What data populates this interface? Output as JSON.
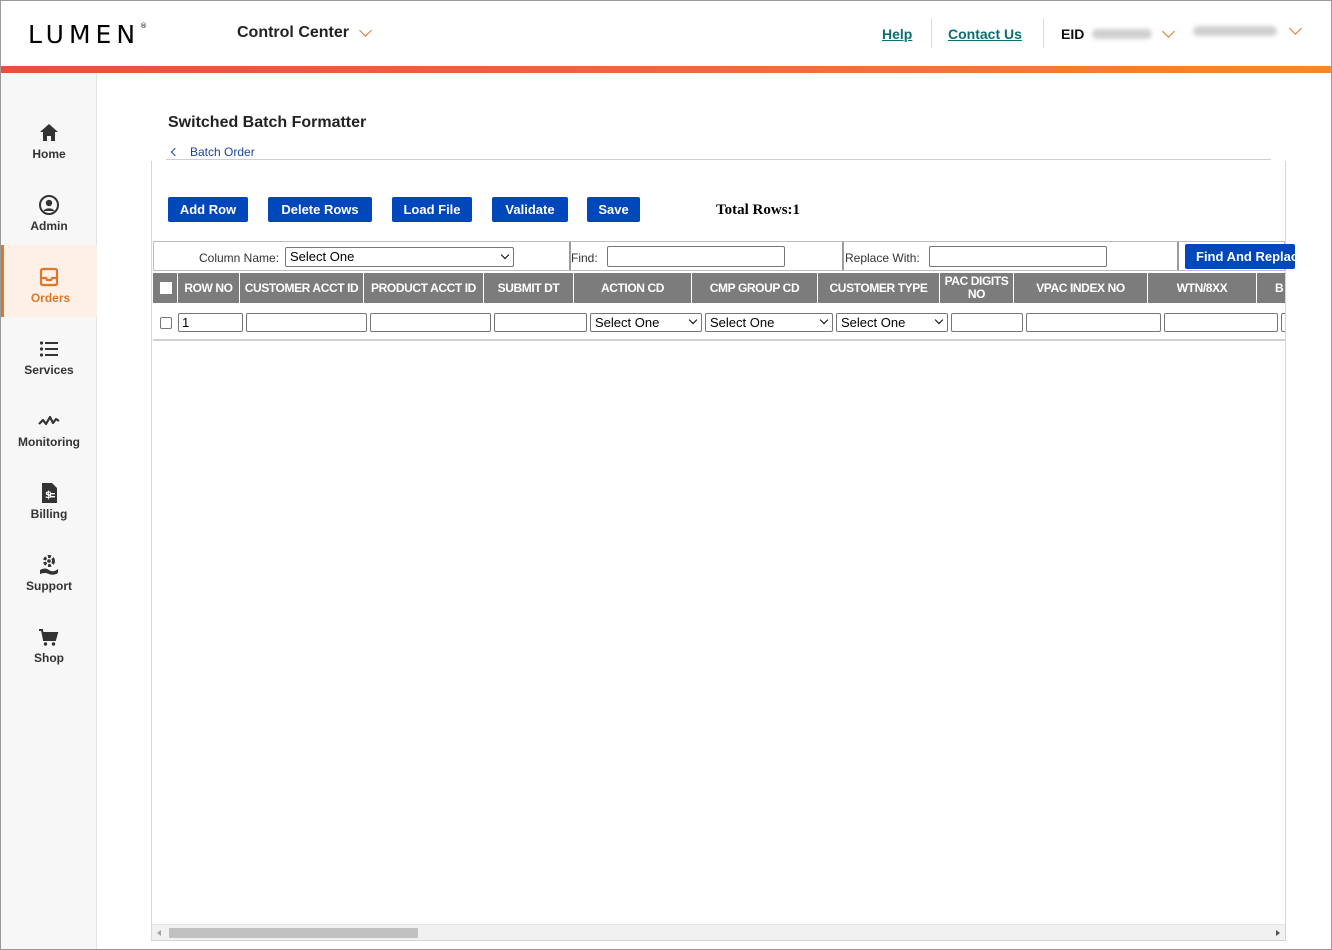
{
  "header": {
    "logo": "LUMEN",
    "logo_mark": "®",
    "product_menu": "Control Center",
    "help": "Help",
    "contact": "Contact Us",
    "eid_label": "EID"
  },
  "sidebar": {
    "items": [
      {
        "label": "Home",
        "icon": "home-icon"
      },
      {
        "label": "Admin",
        "icon": "user-icon"
      },
      {
        "label": "Orders",
        "icon": "inbox-icon"
      },
      {
        "label": "Services",
        "icon": "list-icon"
      },
      {
        "label": "Monitoring",
        "icon": "pulse-icon"
      },
      {
        "label": "Billing",
        "icon": "billing-icon"
      },
      {
        "label": "Support",
        "icon": "support-icon"
      },
      {
        "label": "Shop",
        "icon": "cart-icon"
      }
    ],
    "active": "Orders",
    "accent_color": "#e0762c"
  },
  "main": {
    "title": "Switched Batch Formatter",
    "back_link": "Batch Order",
    "toolbar": {
      "add_row": "Add Row",
      "delete_rows": "Delete Rows",
      "load_file": "Load File",
      "validate": "Validate",
      "save": "Save"
    },
    "total_rows": "Total Rows:1",
    "find_bar": {
      "column_name_label": "Column Name:",
      "column_name_value": "Select One",
      "find_label": "Find:",
      "find_value": "",
      "replace_label": "Replace With:",
      "replace_value": "",
      "button": "Find And Replace"
    },
    "table": {
      "columns": [
        "ROW NO",
        "CUSTOMER ACCT ID",
        "PRODUCT ACCT ID",
        "SUBMIT DT",
        "ACTION CD",
        "CMP GROUP CD",
        "CUSTOMER TYPE",
        "PAC DIGITS NO",
        "VPAC INDEX NO",
        "WTN/8XX",
        "B"
      ],
      "rows": [
        {
          "row_no": "1",
          "customer_acct_id": "",
          "product_acct_id": "",
          "submit_dt": "",
          "action_cd": "Select One",
          "cmp_group_cd": "Select One",
          "customer_type": "Select One",
          "pac_digits_no": "",
          "vpac_index_no": "",
          "wtn_8xx": ""
        }
      ]
    }
  },
  "colors": {
    "primary_button": "#0047bb",
    "table_header": "#7c7c7c",
    "link": "#0b6e71"
  }
}
